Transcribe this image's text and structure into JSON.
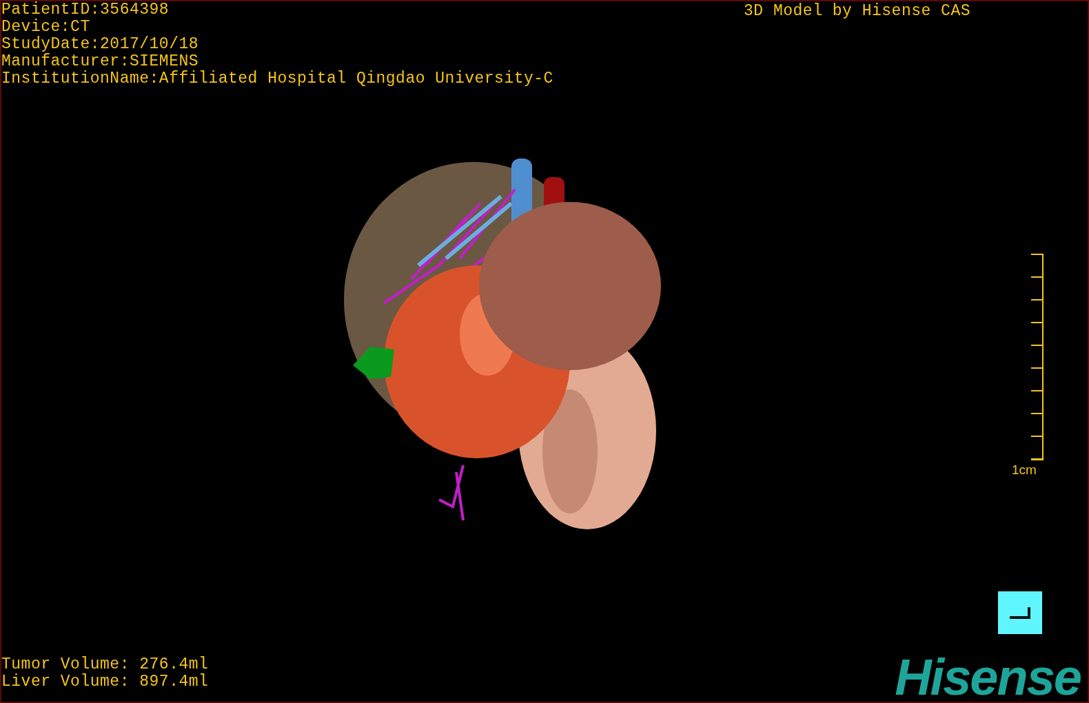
{
  "study_info": [
    "PatientID:3564398",
    "Device:CT",
    "StudyDate:2017/10/18",
    "Manufacturer:SIEMENS",
    "InstitutionName:Affiliated Hospital Qingdao University-C"
  ],
  "title": "3D Model by Hisense CAS",
  "scale": {
    "label": "1cm"
  },
  "volumes": [
    "Tumor Volume: 276.4ml",
    "Liver Volume: 897.4ml"
  ],
  "logo": "Hisense"
}
